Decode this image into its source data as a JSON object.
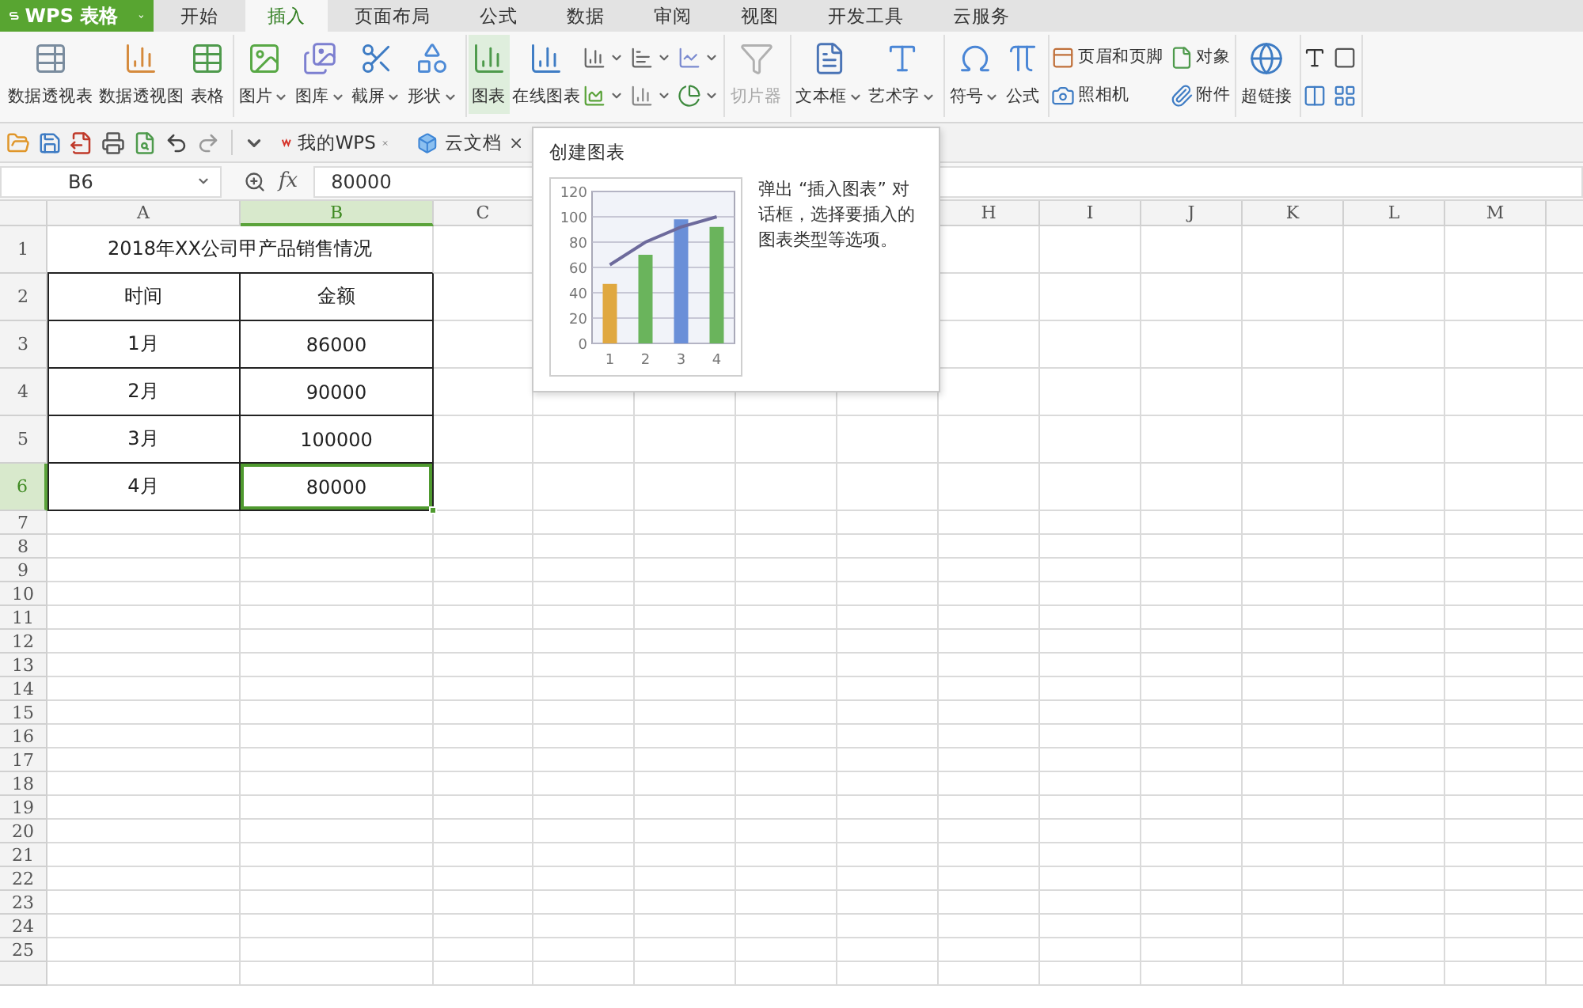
{
  "app": {
    "name": "WPS 表格"
  },
  "menu_tabs": [
    {
      "label": "开始",
      "selected": false
    },
    {
      "label": "插入",
      "selected": true
    },
    {
      "label": "页面布局",
      "selected": false
    },
    {
      "label": "公式",
      "selected": false
    },
    {
      "label": "数据",
      "selected": false
    },
    {
      "label": "审阅",
      "selected": false
    },
    {
      "label": "视图",
      "selected": false
    },
    {
      "label": "开发工具",
      "selected": false
    },
    {
      "label": "云服务",
      "selected": false
    }
  ],
  "ribbon": {
    "groups": [
      {
        "items": [
          {
            "label": "数据透视表",
            "dropdown": false,
            "selected": false,
            "disabled": false
          },
          {
            "label": "数据透视图",
            "dropdown": false,
            "selected": false,
            "disabled": false
          },
          {
            "label": "表格",
            "dropdown": false,
            "selected": false,
            "disabled": false
          }
        ]
      },
      {
        "items": [
          {
            "label": "图片",
            "dropdown": true,
            "selected": false,
            "disabled": false
          },
          {
            "label": "图库",
            "dropdown": true,
            "selected": false,
            "disabled": false
          },
          {
            "label": "截屏",
            "dropdown": true,
            "selected": false,
            "disabled": false
          },
          {
            "label": "形状",
            "dropdown": true,
            "selected": false,
            "disabled": false
          }
        ]
      },
      {
        "items": [
          {
            "label": "图表",
            "dropdown": false,
            "selected": true,
            "disabled": false
          },
          {
            "label": "在线图表",
            "dropdown": false,
            "selected": false,
            "disabled": false
          }
        ],
        "grid": [
          {
            "dropdown": true
          },
          {
            "dropdown": true
          },
          {
            "dropdown": true
          },
          {
            "dropdown": true
          },
          {
            "dropdown": true
          },
          {
            "dropdown": true
          }
        ]
      },
      {
        "items": [
          {
            "label": "切片器",
            "dropdown": false,
            "selected": false,
            "disabled": true
          }
        ]
      },
      {
        "items": [
          {
            "label": "文本框",
            "dropdown": true,
            "selected": false,
            "disabled": false
          },
          {
            "label": "艺术字",
            "dropdown": true,
            "selected": false,
            "disabled": false
          }
        ]
      },
      {
        "items": [
          {
            "label": "符号",
            "dropdown": true,
            "selected": false,
            "disabled": false
          },
          {
            "label": "公式",
            "dropdown": false,
            "selected": false,
            "disabled": false
          }
        ]
      },
      {
        "grid": [
          {
            "label": "页眉和页脚",
            "dropdown": false
          },
          {
            "label": "对象",
            "dropdown": false
          },
          {
            "label": "照相机",
            "dropdown": false
          },
          {
            "label": "附件",
            "dropdown": false
          }
        ]
      },
      {
        "items": [
          {
            "label": "超链接",
            "dropdown": false,
            "selected": false,
            "disabled": false
          }
        ]
      },
      {
        "grid": [
          {
            "dropdown": false
          },
          {
            "dropdown": false
          },
          {
            "dropdown": false
          },
          {
            "dropdown": false
          }
        ]
      }
    ]
  },
  "doc_tabs": [
    {
      "label": "我的WPS"
    },
    {
      "label": "云文档"
    }
  ],
  "formula_bar": {
    "cell_ref": "B6",
    "fx": "fx",
    "value": "80000"
  },
  "sheet": {
    "columns": [
      {
        "kind": "header",
        "label": "A",
        "selected": false
      },
      {
        "kind": "header",
        "label": "B",
        "selected": true
      },
      {
        "kind": "header",
        "label": "C",
        "selected": false
      },
      {
        "kind": "covered"
      },
      {
        "kind": "covered"
      },
      {
        "kind": "covered"
      },
      {
        "kind": "covered"
      },
      {
        "kind": "header",
        "label": "H",
        "selected": false
      },
      {
        "kind": "header",
        "label": "I",
        "selected": false
      },
      {
        "kind": "header",
        "label": "J",
        "selected": false
      },
      {
        "kind": "header",
        "label": "K",
        "selected": false
      },
      {
        "kind": "header",
        "label": "L",
        "selected": false
      },
      {
        "kind": "header",
        "label": "M",
        "selected": false
      },
      {
        "kind": "edge"
      }
    ],
    "rows": [
      {
        "label": "1",
        "selected": false,
        "bordered": false,
        "cells": [
          {
            "text": "2018年XX公司甲产品销售情况",
            "merged": true,
            "selected": false
          }
        ]
      },
      {
        "label": "2",
        "selected": false,
        "bordered": true,
        "cells": [
          {
            "text": "时间",
            "selected": false
          },
          {
            "text": "金额",
            "selected": false
          }
        ]
      },
      {
        "label": "3",
        "selected": false,
        "bordered": true,
        "cells": [
          {
            "text": "1月",
            "selected": false
          },
          {
            "text": "86000",
            "selected": false
          }
        ]
      },
      {
        "label": "4",
        "selected": false,
        "bordered": true,
        "cells": [
          {
            "text": "2月",
            "selected": false
          },
          {
            "text": "90000",
            "selected": false
          }
        ]
      },
      {
        "label": "5",
        "selected": false,
        "bordered": true,
        "cells": [
          {
            "text": "3月",
            "selected": false
          },
          {
            "text": "100000",
            "selected": false
          }
        ]
      },
      {
        "label": "6",
        "selected": true,
        "bordered": true,
        "cells": [
          {
            "text": "4月",
            "selected": false
          },
          {
            "text": "80000",
            "selected": true
          }
        ]
      },
      {
        "label": "7",
        "selected": false
      },
      {
        "label": "8",
        "selected": false
      },
      {
        "label": "9",
        "selected": false
      },
      {
        "label": "10",
        "selected": false
      },
      {
        "label": "11",
        "selected": false
      },
      {
        "label": "12",
        "selected": false
      },
      {
        "label": "13",
        "selected": false
      },
      {
        "label": "14",
        "selected": false
      },
      {
        "label": "15",
        "selected": false
      },
      {
        "label": "16",
        "selected": false
      },
      {
        "label": "17",
        "selected": false
      },
      {
        "label": "18",
        "selected": false
      },
      {
        "label": "19",
        "selected": false
      },
      {
        "label": "20",
        "selected": false
      },
      {
        "label": "21",
        "selected": false
      },
      {
        "label": "22",
        "selected": false
      },
      {
        "label": "23",
        "selected": false
      },
      {
        "label": "24",
        "selected": false
      },
      {
        "label": "25",
        "selected": false
      }
    ]
  },
  "tooltip": {
    "title": "创建图表",
    "text": "弹出 “插入图表” 对话框，选择要插入的图表类型等选项。",
    "chart_data": {
      "type": "bar",
      "categories": [
        "1",
        "2",
        "3",
        "4"
      ],
      "ylim": [
        0,
        120
      ],
      "yticks": [
        0,
        20,
        40,
        60,
        80,
        100,
        120
      ],
      "grid": true,
      "series": [
        {
          "color": "#e0a840",
          "values": [
            47,
            null,
            null,
            null
          ]
        },
        {
          "color": "#6ab45c",
          "values": [
            null,
            70,
            null,
            92
          ]
        },
        {
          "color": "#6a8fd8",
          "values": [
            null,
            null,
            98,
            null
          ]
        },
        {
          "type": "line",
          "color": "#6d6a9c",
          "values": [
            62,
            80,
            92,
            100
          ]
        }
      ]
    }
  }
}
